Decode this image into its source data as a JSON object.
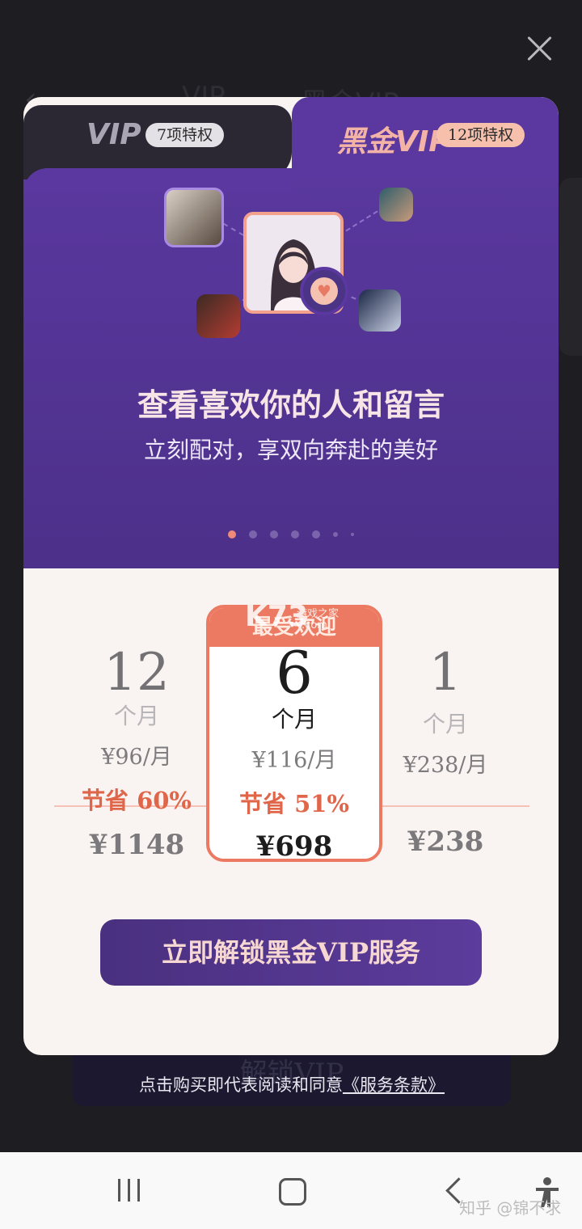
{
  "background": {
    "tab_vip": "VIP",
    "tab_gold": "黑金VIP",
    "panel_ghost": "解锁VIP"
  },
  "tabs": [
    {
      "label": "VIP",
      "badge": "7项特权",
      "selected": false
    },
    {
      "label": "黑金VIP",
      "badge": "12项特权",
      "selected": true
    }
  ],
  "carousel": {
    "headline": "查看喜欢你的人和留言",
    "subline": "立刻配对，享双向奔赴的美好",
    "slide_count": 7,
    "active_index": 0
  },
  "plans": [
    {
      "count": "12",
      "unit": "个月",
      "per_month": "¥96/月",
      "save": "节省 60%",
      "total": "¥1148"
    },
    {
      "count": "6",
      "unit": "个月",
      "per_month": "¥116/月",
      "save": "节省 51%",
      "total": "¥698",
      "ribbon": "最受欢迎",
      "selected": true
    },
    {
      "count": "1",
      "unit": "个月",
      "per_month": "¥238/月",
      "save": "",
      "total": "¥238"
    }
  ],
  "watermark": {
    "brand": "K73",
    "sub": "游戏之家",
    "dotcom": ".com"
  },
  "cta": {
    "label": "立即解锁黑金VIP服务"
  },
  "terms": {
    "text": "点击购买即代表阅读和同意",
    "link": "《服务条款》"
  },
  "system_watermark": "知乎 @锦不求",
  "colors": {
    "accent": "#ec7a62",
    "purple": "#5a389f"
  }
}
